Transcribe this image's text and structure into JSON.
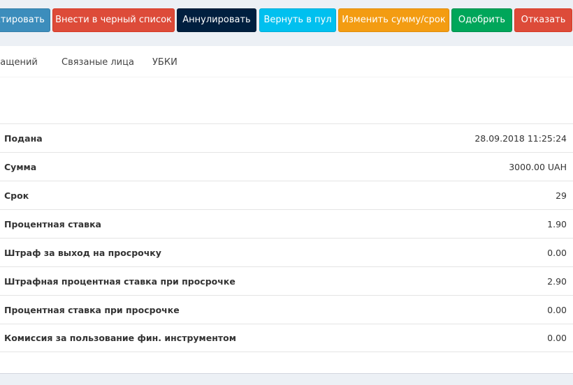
{
  "toolbar": {
    "buttons": [
      {
        "label": "ктировать",
        "color": "#3c8dbc"
      },
      {
        "label": "Внести в черный список",
        "color": "#dd4b39"
      },
      {
        "label": "Аннулировать",
        "color": "#001f3f"
      },
      {
        "label": "Вернуть в пул",
        "color": "#00c0ef"
      },
      {
        "label": "Изменить сумму/срок",
        "color": "#f39c12"
      },
      {
        "label": "Одобрить",
        "color": "#00a65a"
      },
      {
        "label": "Отказать",
        "color": "#dd4b39"
      }
    ]
  },
  "tabs": [
    {
      "label": "ращений"
    },
    {
      "label": "Связаные лица"
    },
    {
      "label": "УБКИ"
    }
  ],
  "details": [
    {
      "label": "Подана",
      "value": "28.09.2018 11:25:24"
    },
    {
      "label": "Сумма",
      "value": "3000.00 UAH"
    },
    {
      "label": "Срок",
      "value": "29"
    },
    {
      "label": "Процентная ставка",
      "value": "1.90"
    },
    {
      "label": "Штраф за выход на просрочку",
      "value": "0.00"
    },
    {
      "label": "Штрафная процентная ставка при просрочке",
      "value": "2.90"
    },
    {
      "label": "Процентная ставка при просрочке",
      "value": "0.00"
    },
    {
      "label": "Комиссия за пользование фин. инструментом",
      "value": "0.00"
    }
  ]
}
